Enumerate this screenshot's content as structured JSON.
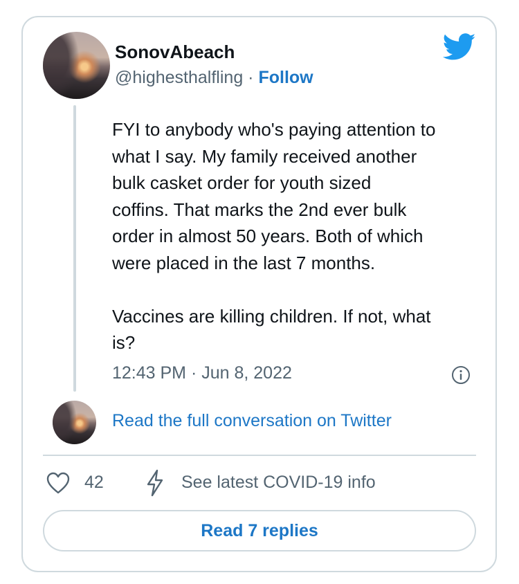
{
  "tweet": {
    "display_name": "SonovAbeach",
    "handle": "@highesthalfling",
    "separator": "·",
    "follow_label": "Follow",
    "text": "FYI to anybody who's paying attention to\nwhat I say. My family received another\nbulk casket order for youth sized\ncoffins. That marks the 2nd ever bulk\norder in almost 50 years. Both of which\nwere placed in the last 7 months.\n\nVaccines are killing children. If not, what\nis?",
    "timestamp": "12:43 PM · Jun 8, 2022"
  },
  "conversation_link": "Read the full conversation on Twitter",
  "actions": {
    "like_count": "42",
    "covid_info_label": "See latest COVID-19 info"
  },
  "replies_button_label": "Read 7 replies",
  "icons": {
    "brand": "twitter-bird-icon",
    "info": "info-icon",
    "like": "heart-icon",
    "covid": "lightning-bolt-icon"
  },
  "colors": {
    "accent": "#1d9bf0",
    "link": "#1d77c6",
    "text": "#0f1419",
    "secondary": "#536471",
    "border": "#cfd9de"
  }
}
